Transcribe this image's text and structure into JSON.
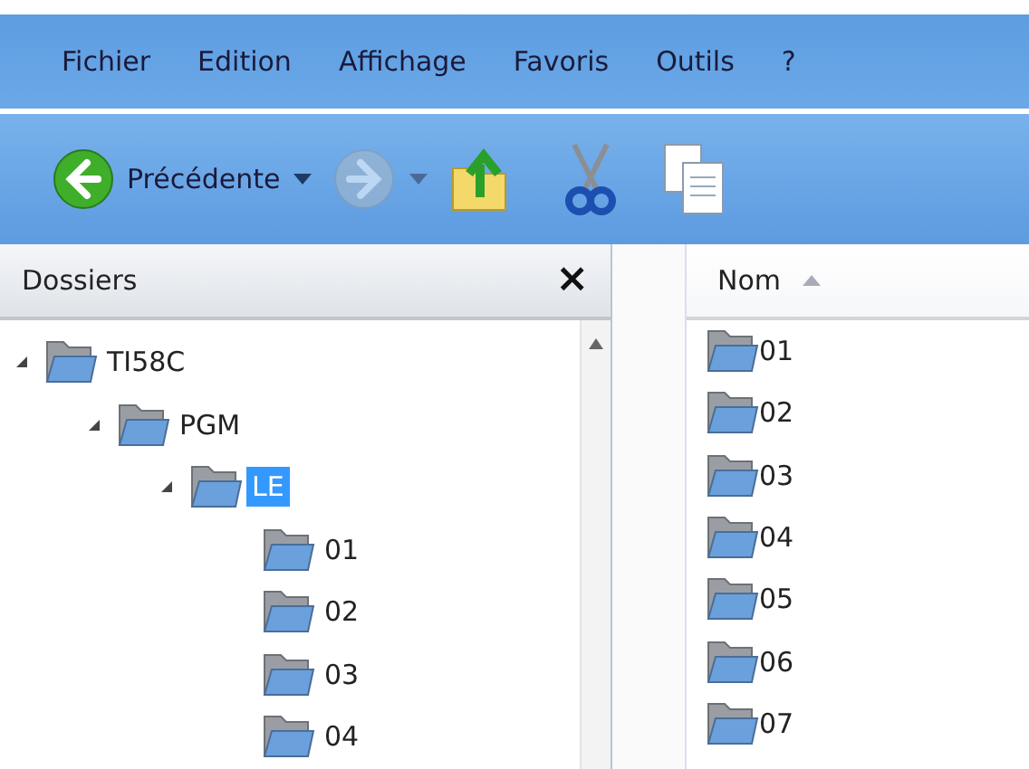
{
  "menu": [
    "Fichier",
    "Edition",
    "Affichage",
    "Favoris",
    "Outils",
    "?"
  ],
  "toolbar": {
    "back_label": "Précédente",
    "forward_disabled": true
  },
  "folders_pane": {
    "title": "Dossiers",
    "close": "×",
    "tree": [
      {
        "label": "TI58C",
        "expanded": true,
        "selected": false,
        "children": [
          {
            "label": "PGM",
            "expanded": true,
            "selected": false,
            "children": [
              {
                "label": "LE",
                "expanded": true,
                "selected": true,
                "children": [
                  {
                    "label": "01",
                    "selected": false
                  },
                  {
                    "label": "02",
                    "selected": false
                  },
                  {
                    "label": "03",
                    "selected": false
                  },
                  {
                    "label": "04",
                    "selected": false
                  }
                ]
              }
            ]
          }
        ]
      }
    ]
  },
  "list": {
    "column": "Nom",
    "sorted_ascending": true,
    "items": [
      "01",
      "02",
      "03",
      "04",
      "05",
      "06",
      "07"
    ]
  }
}
